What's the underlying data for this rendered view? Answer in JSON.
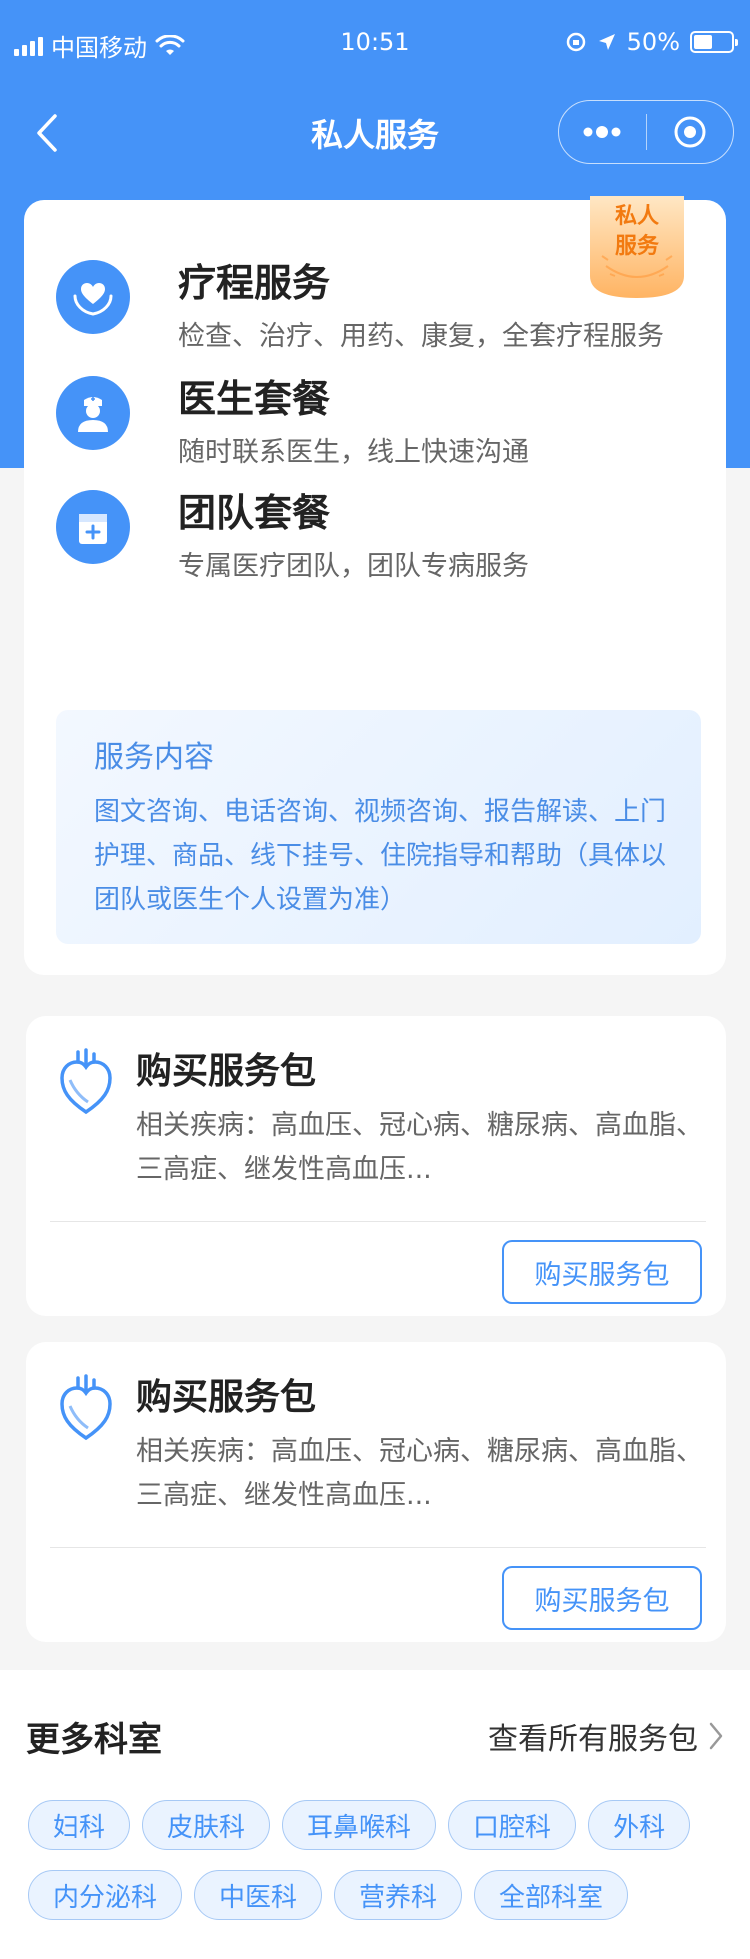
{
  "status_bar": {
    "carrier": "中国移动",
    "time": "10:51",
    "battery": "50%",
    "battery_level": 0.5
  },
  "nav": {
    "title": "私人服务"
  },
  "badge": {
    "line1": "私人",
    "line2": "服务"
  },
  "services": [
    {
      "title": "疗程服务",
      "desc": "检查、治疗、用药、康复，全套疗程服务",
      "icon": "heart-hands-icon"
    },
    {
      "title": "医生套餐",
      "desc": "随时联系医生，线上快速沟通",
      "icon": "doctor-icon"
    },
    {
      "title": "团队套餐",
      "desc": "专属医疗团队，团队专病服务",
      "icon": "medical-kit-icon"
    }
  ],
  "service_content": {
    "title": "服务内容",
    "text": "图文咨询、电话咨询、视频咨询、报告解读、上门护理、商品、线下挂号、住院指导和帮助（具体以团队或医生个人设置为准）"
  },
  "packages": [
    {
      "title": "购买服务包",
      "desc": "相关疾病：高血压、冠心病、糖尿病、高血脂、三高症、继发性高血压...",
      "button": "购买服务包",
      "icon": "heart-icon"
    },
    {
      "title": "购买服务包",
      "desc": "相关疾病：高血压、冠心病、糖尿病、高血脂、三高症、继发性高血压...",
      "button": "购买服务包",
      "icon": "heart-icon"
    }
  ],
  "departments": {
    "title": "更多科室",
    "view_all": "查看所有服务包",
    "tags": [
      "妇科",
      "皮肤科",
      "耳鼻喉科",
      "口腔科",
      "外科",
      "内分泌科",
      "中医科",
      "营养科",
      "全部科室"
    ]
  },
  "colors": {
    "primary": "#4593f8",
    "badge": "#ff9a3c"
  }
}
